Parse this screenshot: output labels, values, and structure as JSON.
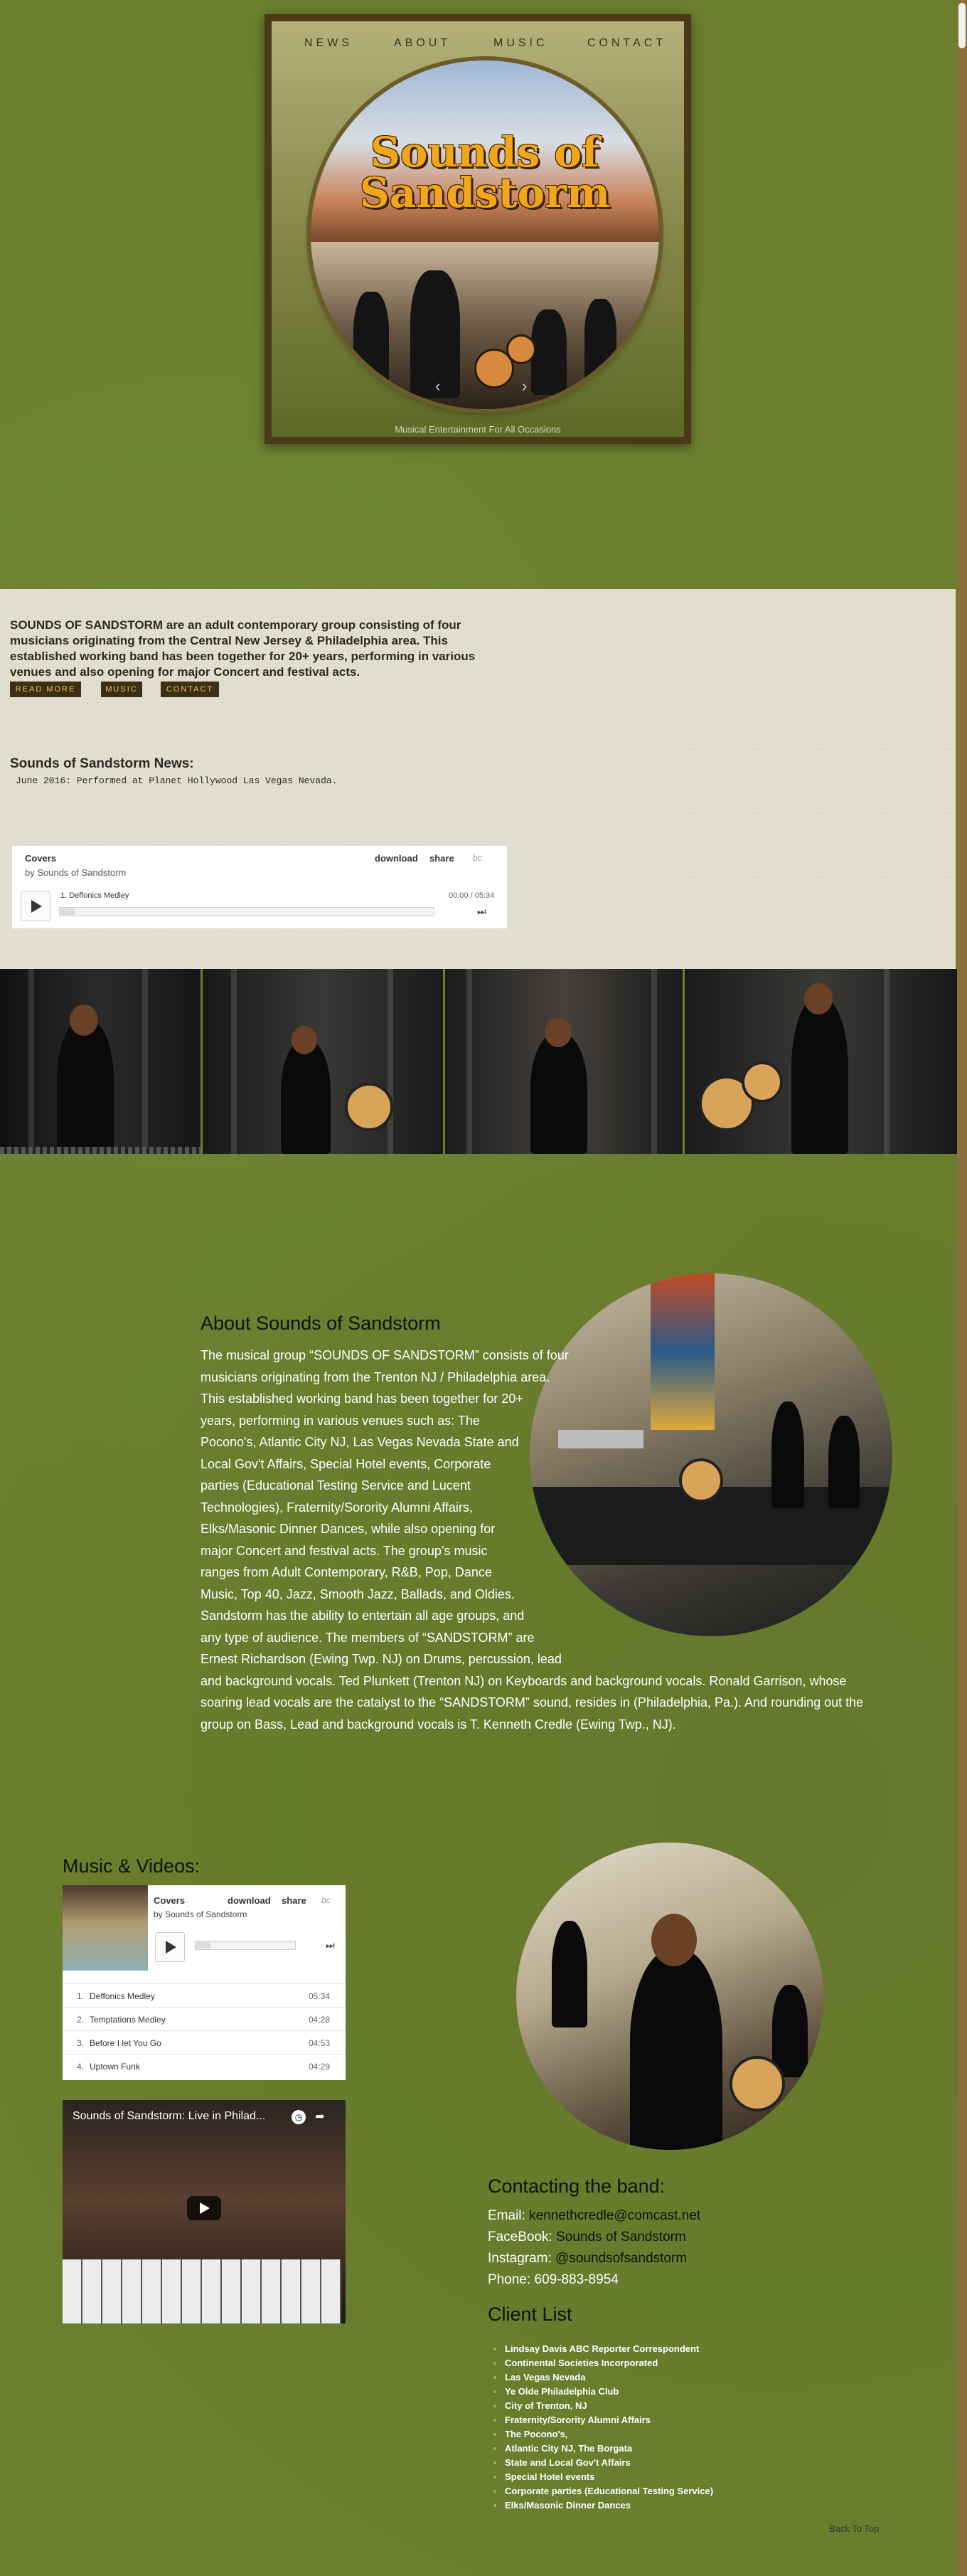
{
  "nav": {
    "news": "NEWS",
    "about": "ABOUT",
    "music": "MUSIC",
    "contact": "CONTACT"
  },
  "logo": {
    "line1": "Sounds of",
    "line2": "Sandstorm"
  },
  "slider": {
    "prev": "‹",
    "next": "›"
  },
  "tagline": "Musical Entertainment For All Occasions",
  "intro": {
    "text": "SOUNDS OF SANDSTORM are an adult contemporary group consisting of four musicians originating from the Central New Jersey & Philadelphia area. This established working band has been together for 20+ years, performing in various venues and also opening for major Concert and festival acts.",
    "buttons": [
      "READ MORE",
      "MUSIC",
      "CONTACT"
    ]
  },
  "news": {
    "title": "Sounds of Sandstorm News:",
    "item": "June 2016: Performed at Planet Hollywood Las Vegas Nevada."
  },
  "player_small": {
    "album": "Covers",
    "artist": "by Sounds of Sandstorm",
    "download": "download",
    "share": "share",
    "bc": "bc",
    "track": "1.   Deffonics Medley",
    "time": "00:00 / 05:34",
    "skip": "⏭"
  },
  "about": {
    "title": "About Sounds of Sandstorm",
    "text": "The musical group “SOUNDS OF SANDSTORM” consists of four musicians originating from the Trenton NJ / Philadelphia area. This established working band has been together for 20+ years, performing in various venues such as: The Pocono's, Atlantic City NJ, Las Vegas Nevada State and Local Gov't Affairs, Special Hotel events, Corporate parties (Educational Testing Service and Lucent Technologies), Fraternity/Sorority Alumni Affairs, Elks/Masonic Dinner Dances, while also opening for major Concert and festival acts. The group’s music ranges from Adult Contemporary, R&B, Pop, Dance Music, Top 40, Jazz, Smooth Jazz, Ballads, and Oldies. Sandstorm has the ability to entertain all age groups, and any type of audience. The members of “SANDSTORM” are Ernest Richardson (Ewing Twp. NJ) on Drums, percussion, lead and background vocals. Ted Plunkett (Trenton NJ) on Keyboards and background vocals. Ronald Garrison, whose soaring lead vocals are the catalyst to the “SANDSTORM” sound, resides in (Philadelphia, Pa.). And rounding out the group on Bass, Lead and background vocals is T. Kenneth Credle (Ewing Twp., NJ)."
  },
  "music": {
    "title": "Music & Videos:",
    "player": {
      "album": "Covers",
      "artist": "by Sounds of Sandstorm",
      "download": "download",
      "share": "share",
      "bc": "bc",
      "skip": "⏭",
      "tracks": [
        {
          "num": "1.",
          "name": "Deffonics Medley",
          "time": "05:34"
        },
        {
          "num": "2.",
          "name": "Temptations Medley",
          "time": "04:28"
        },
        {
          "num": "3.",
          "name": "Before I let You Go",
          "time": "04:53"
        },
        {
          "num": "4.",
          "name": "Uptown Funk",
          "time": "04:29"
        }
      ]
    },
    "video_title": "Sounds of Sandstorm: Live in Philad..."
  },
  "contact": {
    "title": "Contacting the band:",
    "email_label": "Email: ",
    "email": "kennethcredle@comcast.net",
    "facebook_label": "FaceBook: ",
    "facebook": "Sounds of Sandstorm",
    "instagram_label": "Instagram: ",
    "instagram": "@soundsofsandstorm",
    "phone": "Phone: 609-883-8954"
  },
  "clients": {
    "title": "Client List",
    "items": [
      "Lindsay Davis ABC Reporter Correspondent",
      "Continental Societies Incorporated",
      "Las Vegas Nevada",
      "Ye Olde Philadelphia Club",
      "City of Trenton, NJ",
      "Fraternity/Sorority Alumni Affairs",
      "The Pocono's,",
      "Atlantic City NJ, The Borgata",
      "State and Local Gov't Affairs",
      "Special Hotel events",
      "Corporate parties (Educational Testing Service)",
      "Elks/Masonic Dinner Dances"
    ]
  },
  "back_to_top": "Back To Top"
}
